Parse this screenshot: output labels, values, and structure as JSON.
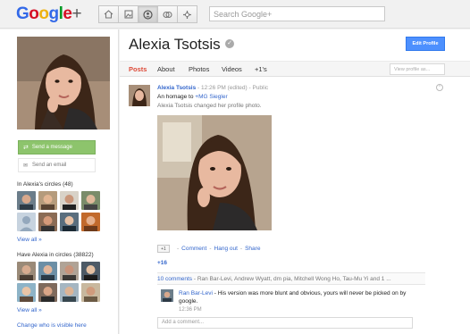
{
  "topbar": {
    "logo_text": "Google",
    "logo_plus": "+",
    "logo_colors": [
      "#3369e8",
      "#d50f25",
      "#eeb211",
      "#3369e8",
      "#009925",
      "#d50f25"
    ],
    "nav_icons": [
      "home-icon",
      "photos-icon",
      "profile-icon",
      "circles-icon",
      "games-icon"
    ],
    "search_placeholder": "Search Google+"
  },
  "left": {
    "send_message": "Send a message",
    "send_email": "Send an email",
    "circles_title": "In Alexia's circles (48)",
    "view_all_1": "View all »",
    "have_title": "Have Alexia in circles (38822)",
    "view_all_2": "View all »",
    "who_visible": "Change who is visible here"
  },
  "profile": {
    "name": "Alexia Tsotsis",
    "edit_button": "Edit Profile",
    "tabs": [
      "Posts",
      "About",
      "Photos",
      "Videos",
      "+1's"
    ],
    "view_as_placeholder": "View profile as..."
  },
  "post": {
    "author": "Alexia Tsotsis",
    "meta": "- 12:26 PM (edited) - Public",
    "text": "An homage to",
    "mention": "+MG Siegler",
    "note": "Alexia Tsotsis changed her profile photo.",
    "plusone_label": "+1",
    "actions": [
      "Comment",
      "Hang out",
      "Share"
    ],
    "plus_count": "+16",
    "comments_count": "10 comments",
    "commenters": "- Ran Bar-Levi, Andrew Wyatt, dm pia, Mitchell Wong Ho, Tau-Mu Yi and 1 ...",
    "comment_author": "Ran Bar-Levi",
    "comment_text": "- His version was more blunt and obvious, yours will never be picked on by google.",
    "comment_time": "12:36 PM",
    "add_comment_placeholder": "Add a comment..."
  },
  "colors": {
    "accent_red": "#dd4b39",
    "link_blue": "#3366cc",
    "message_green": "#8dc46c",
    "edit_blue": "#4d90fe"
  }
}
